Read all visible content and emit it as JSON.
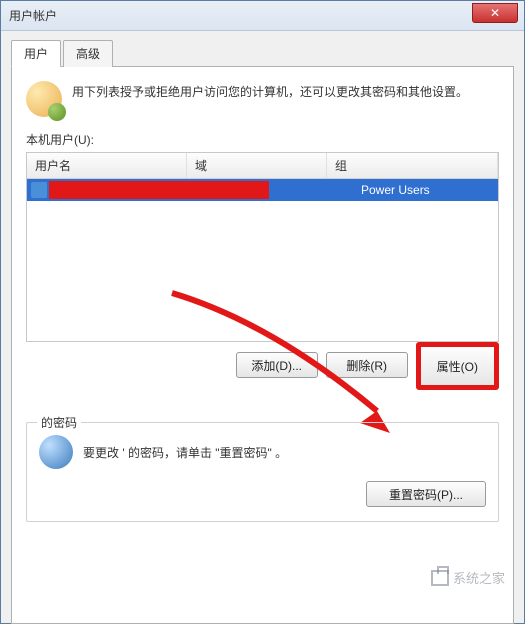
{
  "window": {
    "title": "用户帐户"
  },
  "tabs": {
    "user": "用户",
    "advanced": "高级"
  },
  "intro": "用下列表授予或拒绝用户访问您的计算机，还可以更改其密码和其他设置。",
  "listLabel": "本机用户(U):",
  "columns": {
    "username": "用户名",
    "domain": "域",
    "group": "组"
  },
  "row": {
    "username": "",
    "domain": "",
    "group": "Power Users"
  },
  "buttons": {
    "add": "添加(D)...",
    "remove": "删除(R)",
    "properties": "属性(O)"
  },
  "password": {
    "legend": "的密码",
    "text": "要更改 ' 的密码，请单击 \"重置密码\" 。",
    "reset": "重置密码(P)..."
  },
  "watermark": "系统之家"
}
